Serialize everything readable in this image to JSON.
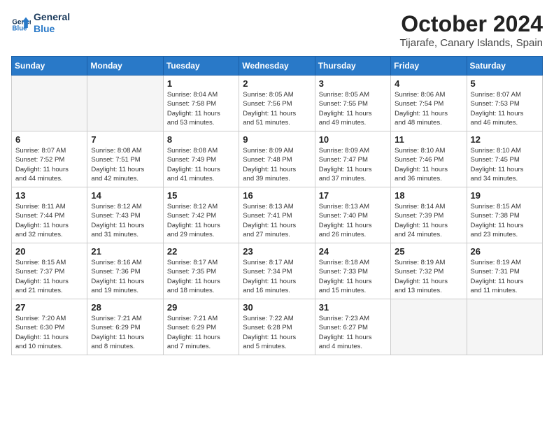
{
  "logo": {
    "line1": "General",
    "line2": "Blue"
  },
  "title": "October 2024",
  "subtitle": "Tijarafe, Canary Islands, Spain",
  "days_header": [
    "Sunday",
    "Monday",
    "Tuesday",
    "Wednesday",
    "Thursday",
    "Friday",
    "Saturday"
  ],
  "weeks": [
    [
      {
        "day": "",
        "info": ""
      },
      {
        "day": "",
        "info": ""
      },
      {
        "day": "1",
        "info": "Sunrise: 8:04 AM\nSunset: 7:58 PM\nDaylight: 11 hours\nand 53 minutes."
      },
      {
        "day": "2",
        "info": "Sunrise: 8:05 AM\nSunset: 7:56 PM\nDaylight: 11 hours\nand 51 minutes."
      },
      {
        "day": "3",
        "info": "Sunrise: 8:05 AM\nSunset: 7:55 PM\nDaylight: 11 hours\nand 49 minutes."
      },
      {
        "day": "4",
        "info": "Sunrise: 8:06 AM\nSunset: 7:54 PM\nDaylight: 11 hours\nand 48 minutes."
      },
      {
        "day": "5",
        "info": "Sunrise: 8:07 AM\nSunset: 7:53 PM\nDaylight: 11 hours\nand 46 minutes."
      }
    ],
    [
      {
        "day": "6",
        "info": "Sunrise: 8:07 AM\nSunset: 7:52 PM\nDaylight: 11 hours\nand 44 minutes."
      },
      {
        "day": "7",
        "info": "Sunrise: 8:08 AM\nSunset: 7:51 PM\nDaylight: 11 hours\nand 42 minutes."
      },
      {
        "day": "8",
        "info": "Sunrise: 8:08 AM\nSunset: 7:49 PM\nDaylight: 11 hours\nand 41 minutes."
      },
      {
        "day": "9",
        "info": "Sunrise: 8:09 AM\nSunset: 7:48 PM\nDaylight: 11 hours\nand 39 minutes."
      },
      {
        "day": "10",
        "info": "Sunrise: 8:09 AM\nSunset: 7:47 PM\nDaylight: 11 hours\nand 37 minutes."
      },
      {
        "day": "11",
        "info": "Sunrise: 8:10 AM\nSunset: 7:46 PM\nDaylight: 11 hours\nand 36 minutes."
      },
      {
        "day": "12",
        "info": "Sunrise: 8:10 AM\nSunset: 7:45 PM\nDaylight: 11 hours\nand 34 minutes."
      }
    ],
    [
      {
        "day": "13",
        "info": "Sunrise: 8:11 AM\nSunset: 7:44 PM\nDaylight: 11 hours\nand 32 minutes."
      },
      {
        "day": "14",
        "info": "Sunrise: 8:12 AM\nSunset: 7:43 PM\nDaylight: 11 hours\nand 31 minutes."
      },
      {
        "day": "15",
        "info": "Sunrise: 8:12 AM\nSunset: 7:42 PM\nDaylight: 11 hours\nand 29 minutes."
      },
      {
        "day": "16",
        "info": "Sunrise: 8:13 AM\nSunset: 7:41 PM\nDaylight: 11 hours\nand 27 minutes."
      },
      {
        "day": "17",
        "info": "Sunrise: 8:13 AM\nSunset: 7:40 PM\nDaylight: 11 hours\nand 26 minutes."
      },
      {
        "day": "18",
        "info": "Sunrise: 8:14 AM\nSunset: 7:39 PM\nDaylight: 11 hours\nand 24 minutes."
      },
      {
        "day": "19",
        "info": "Sunrise: 8:15 AM\nSunset: 7:38 PM\nDaylight: 11 hours\nand 23 minutes."
      }
    ],
    [
      {
        "day": "20",
        "info": "Sunrise: 8:15 AM\nSunset: 7:37 PM\nDaylight: 11 hours\nand 21 minutes."
      },
      {
        "day": "21",
        "info": "Sunrise: 8:16 AM\nSunset: 7:36 PM\nDaylight: 11 hours\nand 19 minutes."
      },
      {
        "day": "22",
        "info": "Sunrise: 8:17 AM\nSunset: 7:35 PM\nDaylight: 11 hours\nand 18 minutes."
      },
      {
        "day": "23",
        "info": "Sunrise: 8:17 AM\nSunset: 7:34 PM\nDaylight: 11 hours\nand 16 minutes."
      },
      {
        "day": "24",
        "info": "Sunrise: 8:18 AM\nSunset: 7:33 PM\nDaylight: 11 hours\nand 15 minutes."
      },
      {
        "day": "25",
        "info": "Sunrise: 8:19 AM\nSunset: 7:32 PM\nDaylight: 11 hours\nand 13 minutes."
      },
      {
        "day": "26",
        "info": "Sunrise: 8:19 AM\nSunset: 7:31 PM\nDaylight: 11 hours\nand 11 minutes."
      }
    ],
    [
      {
        "day": "27",
        "info": "Sunrise: 7:20 AM\nSunset: 6:30 PM\nDaylight: 11 hours\nand 10 minutes."
      },
      {
        "day": "28",
        "info": "Sunrise: 7:21 AM\nSunset: 6:29 PM\nDaylight: 11 hours\nand 8 minutes."
      },
      {
        "day": "29",
        "info": "Sunrise: 7:21 AM\nSunset: 6:29 PM\nDaylight: 11 hours\nand 7 minutes."
      },
      {
        "day": "30",
        "info": "Sunrise: 7:22 AM\nSunset: 6:28 PM\nDaylight: 11 hours\nand 5 minutes."
      },
      {
        "day": "31",
        "info": "Sunrise: 7:23 AM\nSunset: 6:27 PM\nDaylight: 11 hours\nand 4 minutes."
      },
      {
        "day": "",
        "info": ""
      },
      {
        "day": "",
        "info": ""
      }
    ]
  ]
}
